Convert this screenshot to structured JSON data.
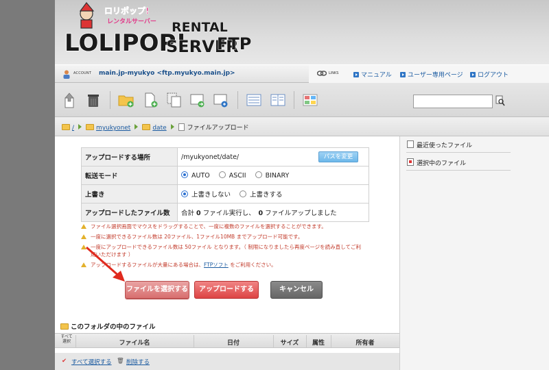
{
  "header": {
    "logo_top": "ロリポップ!",
    "logo_small": "レンタルサーバー",
    "logo_main": "LOLIPOP!",
    "logo_rental": "RENTAL",
    "logo_server": "SERVER",
    "logo_ftp": "FTP"
  },
  "account": {
    "label": "ACCOUNT",
    "value": "main.jp-myukyo <ftp.myukyo.main.jp>"
  },
  "links": {
    "label": "LINKS",
    "items": [
      "マニュアル",
      "ユーザー専用ページ",
      "ログアウト"
    ]
  },
  "toolbar": {
    "icons": [
      "upload-icon",
      "trash-icon",
      "new-folder-icon",
      "new-file-icon",
      "copy-icon",
      "move-icon",
      "archive-icon",
      "list-view-icon",
      "detail-view-icon",
      "thumbnail-view-icon"
    ]
  },
  "breadcrumb": {
    "root": "/",
    "dir1": "myukyonet",
    "dir2": "date",
    "current": "ファイルアップロード"
  },
  "settings": {
    "upload_location_label": "アップロードする場所",
    "upload_location_value": "/myukyonet/date/",
    "change_path_button": "パスを変更",
    "transfer_mode_label": "転送モード",
    "transfer_modes": [
      "AUTO",
      "ASCII",
      "BINARY"
    ],
    "transfer_mode_selected": "AUTO",
    "overwrite_label": "上書き",
    "overwrite_options": [
      "上書きしない",
      "上書きする"
    ],
    "overwrite_selected": "上書きしない",
    "uploaded_count_label": "アップロードしたファイル数",
    "uploaded_count_prefix": "合計",
    "uploaded_executed": "0",
    "uploaded_executed_suffix": "ファイル実行し、",
    "uploaded_done": "0",
    "uploaded_done_suffix": "ファイルアップしました"
  },
  "notes": [
    "ファイル選択画面でマウスをドラッグすることで、一度に複数のファイルを選択することができます。",
    "一度に選択できるファイル数は 20ファイル、1ファイル10MB までアップロード可能です。",
    "一度にアップロードできるファイル数は 50ファイル となります。（ 制限になりましたら再度ページを読み直してご利",
    "用いただけます ）",
    "アップロードするファイルが大量にある場合は、",
    "FTPソフト",
    "をご利用ください。"
  ],
  "buttons": {
    "select_files": "ファイルを選択する",
    "upload": "アップロードする",
    "cancel": "キャンセル"
  },
  "file_list": {
    "title": "このフォルダの中のファイル",
    "select_all_header": "すべて選択",
    "columns": [
      "ファイル名",
      "日付",
      "サイズ",
      "属性",
      "所有者"
    ],
    "select_all_link": "すべて選択する",
    "delete_link": "削除する"
  },
  "sidebar": {
    "items": [
      "最近使ったファイル",
      "選択中のファイル"
    ]
  },
  "colors": {
    "link": "#1a5aa0",
    "note_red": "#c23a2a",
    "upload_button": "#dd4444",
    "select_button": "#d86f6f",
    "cancel_button": "#666666",
    "path_button": "#6db8ea"
  }
}
